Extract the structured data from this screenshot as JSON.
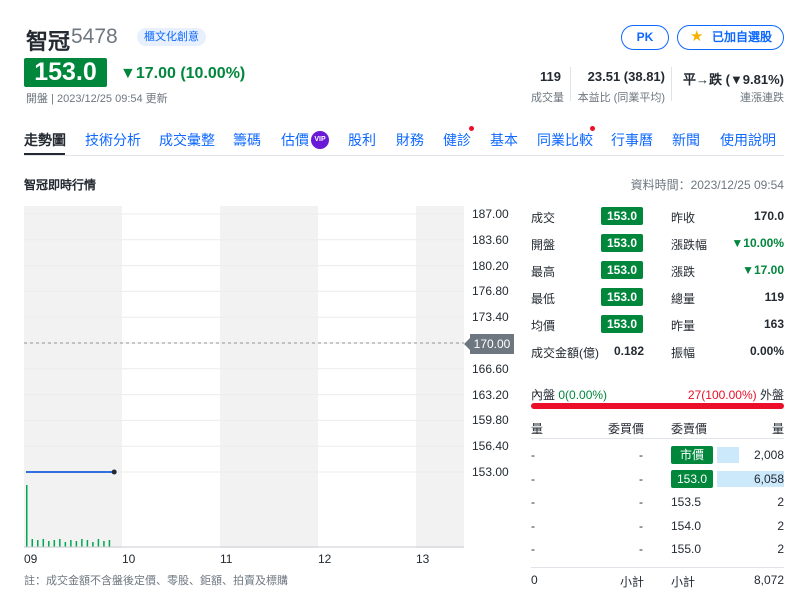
{
  "header": {
    "name": "智冠",
    "code": "5478",
    "category": "櫃文化創意",
    "pk_label": "PK",
    "watch_label": "已加自選股",
    "price": "153.0",
    "change": "▼17.00 (10.00%)",
    "status": "開盤 | 2023/12/25 09:54 更新",
    "stats": [
      {
        "value": "119",
        "label": "成交量"
      },
      {
        "value": "23.51 (38.81)",
        "label": "本益比 (同業平均)"
      },
      {
        "value": "平→跌 (▼9.81%)",
        "label": "連漲連跌"
      }
    ]
  },
  "tabs": [
    "走勢圖",
    "技術分析",
    "成交彙整",
    "籌碼",
    "估價",
    "股利",
    "財務",
    "健診",
    "基本",
    "同業比較",
    "行事曆",
    "新聞",
    "使用說明"
  ],
  "vip_label": "VIP",
  "section": {
    "title": "智冠即時行情",
    "data_time": "資料時間：2023/12/25 09:54"
  },
  "chart": {
    "y_ticks": [
      "187.00",
      "183.60",
      "180.20",
      "176.80",
      "173.40",
      "170.00",
      "166.60",
      "163.20",
      "159.80",
      "156.40",
      "153.00"
    ],
    "x_ticks": [
      "09",
      "10",
      "11",
      "12",
      "13"
    ],
    "ref_price": "170.00",
    "footnote": "註：成交金額不含盤後定價、零股、鉅額、拍賣及標購"
  },
  "chart_data": {
    "type": "line",
    "x": [
      "09:00",
      "09:54"
    ],
    "series": [
      {
        "values": [
          153.0,
          153.0
        ]
      }
    ],
    "reference": 170.0,
    "ylim": [
      153.0,
      187.0
    ],
    "xlim": [
      "09:00",
      "13:30"
    ],
    "x_ticks": [
      "09",
      "10",
      "11",
      "12",
      "13"
    ],
    "volume_bars": "small volume bars between 09:00 and 09:54",
    "grid": true
  },
  "quote": {
    "left": [
      {
        "label": "成交",
        "value": "153.0"
      },
      {
        "label": "開盤",
        "value": "153.0"
      },
      {
        "label": "最高",
        "value": "153.0"
      },
      {
        "label": "最低",
        "value": "153.0"
      },
      {
        "label": "均價",
        "value": "153.0"
      },
      {
        "label": "成交金額(億)",
        "value": "0.182"
      }
    ],
    "right": [
      {
        "label": "昨收",
        "value": "170.0"
      },
      {
        "label": "漲跌幅",
        "value": "▼10.00%"
      },
      {
        "label": "漲跌",
        "value": "▼17.00"
      },
      {
        "label": "總量",
        "value": "119"
      },
      {
        "label": "昨量",
        "value": "163"
      },
      {
        "label": "振幅",
        "value": "0.00%"
      }
    ]
  },
  "inout": {
    "inner_label": "內盤",
    "inner_value": "0(0.00%)",
    "outer_value": "27(100.00%)",
    "outer_label": "外盤",
    "outer_share": 1.0
  },
  "orderbook": {
    "headers": [
      "量",
      "委買價",
      "委賣價",
      "量"
    ],
    "bids": [
      [
        "-",
        "-"
      ],
      [
        "-",
        "-"
      ],
      [
        "-",
        "-"
      ],
      [
        "-",
        "-"
      ],
      [
        "-",
        "-"
      ]
    ],
    "asks": [
      {
        "price": "市價",
        "vol": "2,008",
        "share": 0.33
      },
      {
        "price": "153.0",
        "vol": "6,058",
        "share": 1.0
      },
      {
        "price": "153.5",
        "vol": "2",
        "share": 0
      },
      {
        "price": "154.0",
        "vol": "2",
        "share": 0
      },
      {
        "price": "155.0",
        "vol": "2",
        "share": 0
      }
    ],
    "footer": {
      "bid_total": "0",
      "bid_label": "小計",
      "ask_label": "小計",
      "ask_total": "8,072"
    }
  },
  "colors": {
    "down": "#00873c",
    "up": "#eb0f29",
    "accent": "#0f69ff"
  }
}
